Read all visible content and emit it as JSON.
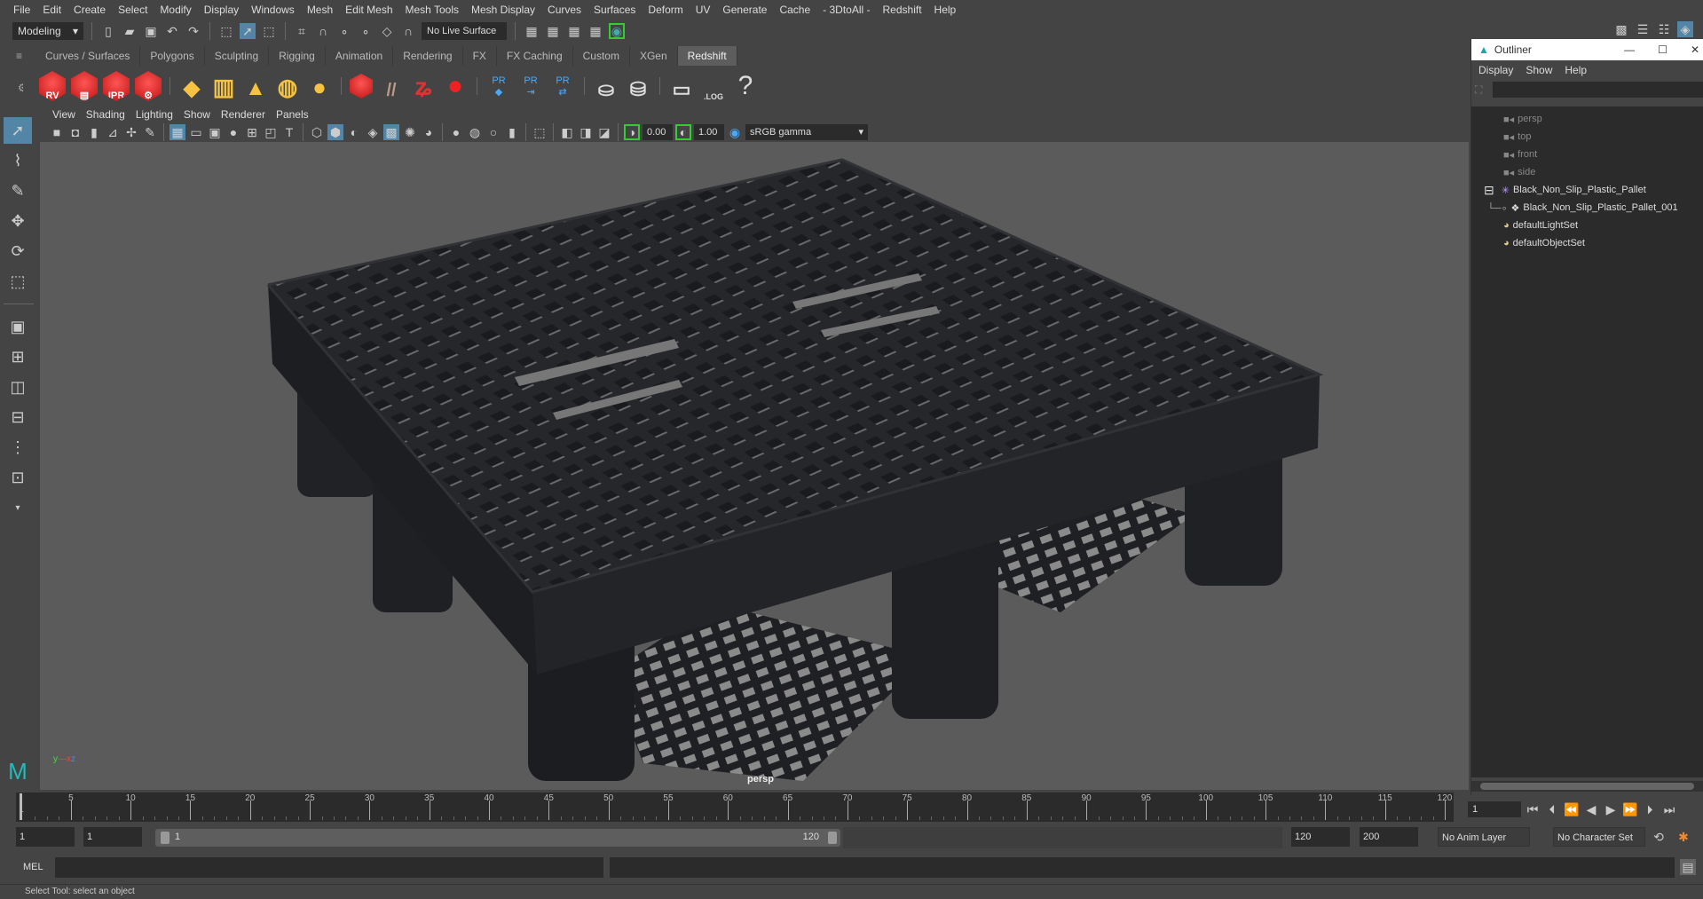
{
  "menubar": [
    "File",
    "Edit",
    "Create",
    "Select",
    "Modify",
    "Display",
    "Windows",
    "Mesh",
    "Edit Mesh",
    "Mesh Tools",
    "Mesh Display",
    "Curves",
    "Surfaces",
    "Deform",
    "UV",
    "Generate",
    "Cache",
    "- 3DtoAll -",
    "Redshift",
    "Help"
  ],
  "statusline": {
    "mode": "Modeling",
    "live_surface": "No Live Surface"
  },
  "shelf_tabs": [
    "Curves / Surfaces",
    "Polygons",
    "Sculpting",
    "Rigging",
    "Animation",
    "Rendering",
    "FX",
    "FX Caching",
    "Custom",
    "XGen",
    "Redshift"
  ],
  "shelf_active": "Redshift",
  "shelf_icons": {
    "rv": "RV",
    "ipr": "IPR",
    "pr": "PR",
    "log": ".LOG",
    "help": "?"
  },
  "panel_menu": [
    "View",
    "Shading",
    "Lighting",
    "Show",
    "Renderer",
    "Panels"
  ],
  "viewport_toolbar": {
    "exposure": "0.00",
    "gamma": "1.00",
    "color_space": "sRGB gamma"
  },
  "viewport": {
    "camera_label": "persp",
    "background": "#5b5b5b",
    "model_color": "#25272b"
  },
  "outliner": {
    "title": "Outliner",
    "menu": [
      "Display",
      "Show",
      "Help"
    ],
    "items": [
      {
        "label": "persp",
        "type": "camera"
      },
      {
        "label": "top",
        "type": "camera"
      },
      {
        "label": "front",
        "type": "camera"
      },
      {
        "label": "side",
        "type": "camera"
      },
      {
        "label": "Black_Non_Slip_Plastic_Pallet",
        "type": "group"
      },
      {
        "label": "Black_Non_Slip_Plastic_Pallet_001",
        "type": "mesh"
      },
      {
        "label": "defaultLightSet",
        "type": "set"
      },
      {
        "label": "defaultObjectSet",
        "type": "set"
      }
    ]
  },
  "timeline": {
    "start_label": "1",
    "ticks": [
      5,
      10,
      15,
      20,
      25,
      30,
      35,
      40,
      45,
      50,
      55,
      60,
      65,
      70,
      75,
      80,
      85,
      90,
      95,
      100,
      105,
      110,
      115,
      120
    ],
    "current_frame": "1"
  },
  "range": {
    "start": "1",
    "playback_start": "1",
    "slider_start": "1",
    "slider_end": "120",
    "playback_end": "120",
    "end": "200",
    "anim_layer": "No Anim Layer",
    "character_set": "No Character Set"
  },
  "mel": {
    "label": "MEL"
  },
  "helpline": "Select Tool: select an object",
  "accent": "#5285a6"
}
